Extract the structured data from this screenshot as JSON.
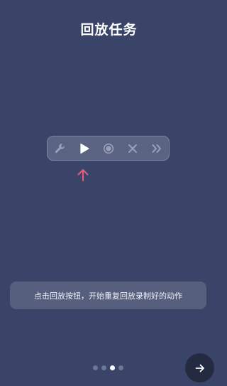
{
  "page": {
    "title": "回放任务"
  },
  "toolbar": {
    "buttons": [
      {
        "icon": "wrench-icon",
        "active": false
      },
      {
        "icon": "play-icon",
        "active": true
      },
      {
        "icon": "record-icon",
        "active": false
      },
      {
        "icon": "close-icon",
        "active": false
      },
      {
        "icon": "double-chevron-right-icon",
        "active": false
      }
    ]
  },
  "hint": {
    "text": "点击回放按钮，开始重复回放录制好的动作"
  },
  "pager": {
    "total": 4,
    "current": 3
  },
  "colors": {
    "background": "#394468",
    "toolbar": "#5a6482",
    "accent_arrow": "#e85d75",
    "hint_box": "#56607e",
    "next_button": "#242b40",
    "inactive_icon": "#9aa1b8"
  }
}
